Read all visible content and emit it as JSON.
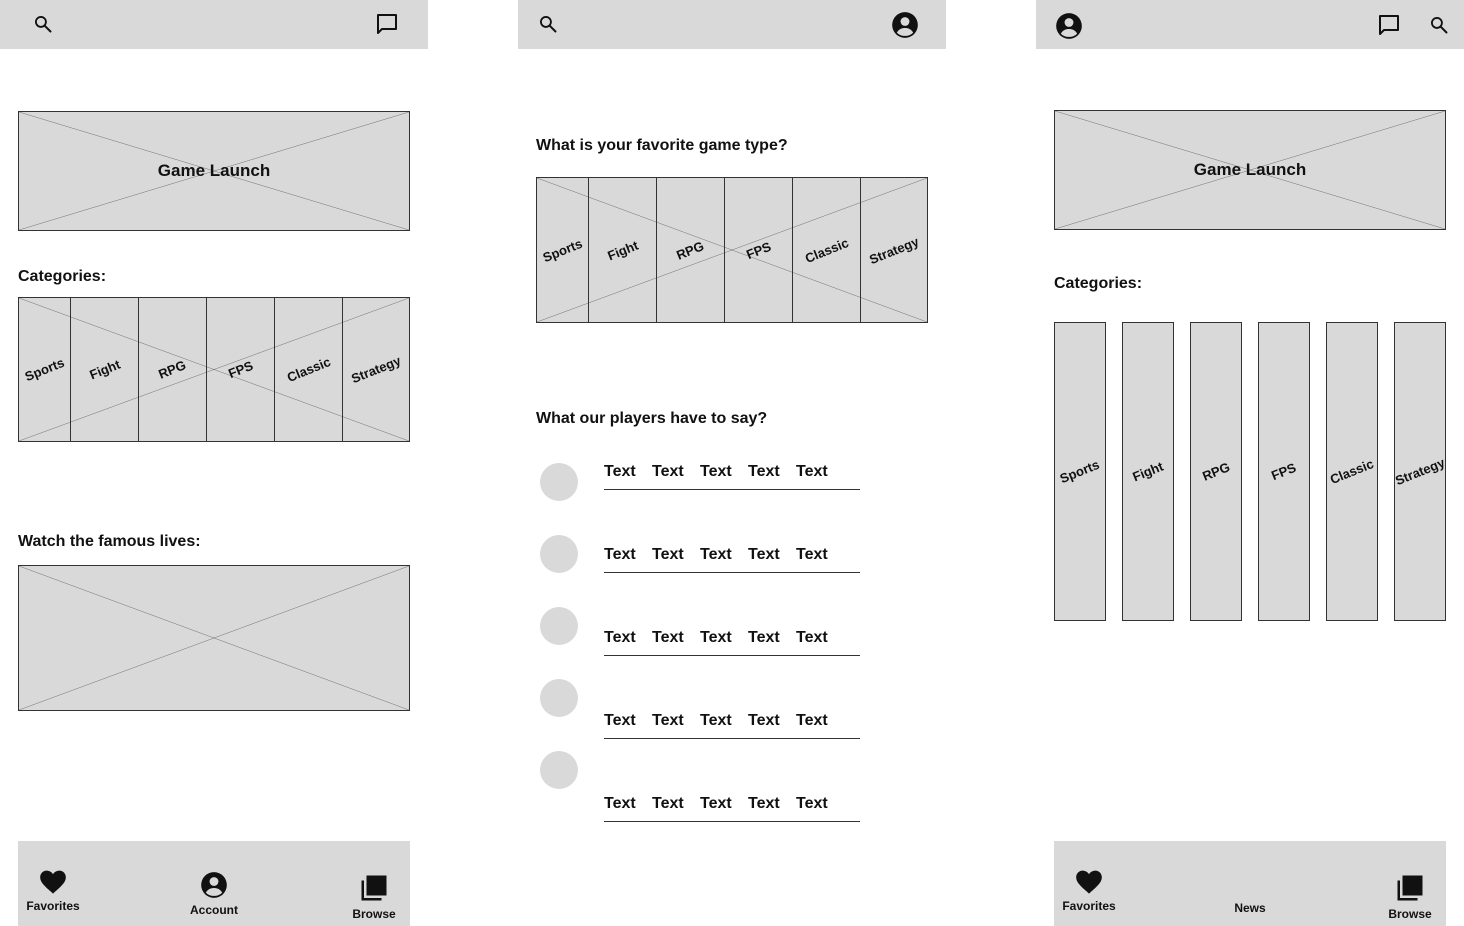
{
  "screens": {
    "home": {
      "hero_label": "Game Launch",
      "categories_title": "Categories:",
      "categories": [
        "Sports",
        "Fight",
        "RPG",
        "FPS",
        "Classic",
        "Strategy"
      ],
      "lives_title": "Watch the famous lives:",
      "nav": {
        "favorites": "Favorites",
        "account": "Account",
        "browse": "Browse"
      }
    },
    "survey": {
      "question": "What is your favorite game type?",
      "categories": [
        "Sports",
        "Fight",
        "RPG",
        "FPS",
        "Classic",
        "Strategy"
      ],
      "testimonials_title": "What our players have to say?",
      "reviews": [
        [
          "Text",
          "Text",
          "Text",
          "Text",
          "Text"
        ],
        [
          "Text",
          "Text",
          "Text",
          "Text",
          "Text"
        ],
        [
          "Text",
          "Text",
          "Text",
          "Text",
          "Text"
        ],
        [
          "Text",
          "Text",
          "Text",
          "Text",
          "Text"
        ],
        [
          "Text",
          "Text",
          "Text",
          "Text",
          "Text"
        ]
      ]
    },
    "browse": {
      "hero_label": "Game Launch",
      "categories_title": "Categories:",
      "categories": [
        "Sports",
        "Fight",
        "RPG",
        "FPS",
        "Classic",
        "Strategy"
      ],
      "nav": {
        "favorites": "Favorites",
        "news": "News",
        "browse": "Browse"
      }
    }
  },
  "colors": {
    "placeholder": "#d9d9d9",
    "stroke": "#333333",
    "text": "#111111"
  },
  "icons": [
    "search-icon",
    "chat-icon",
    "account-circle-icon",
    "heart-icon",
    "library-icon"
  ]
}
